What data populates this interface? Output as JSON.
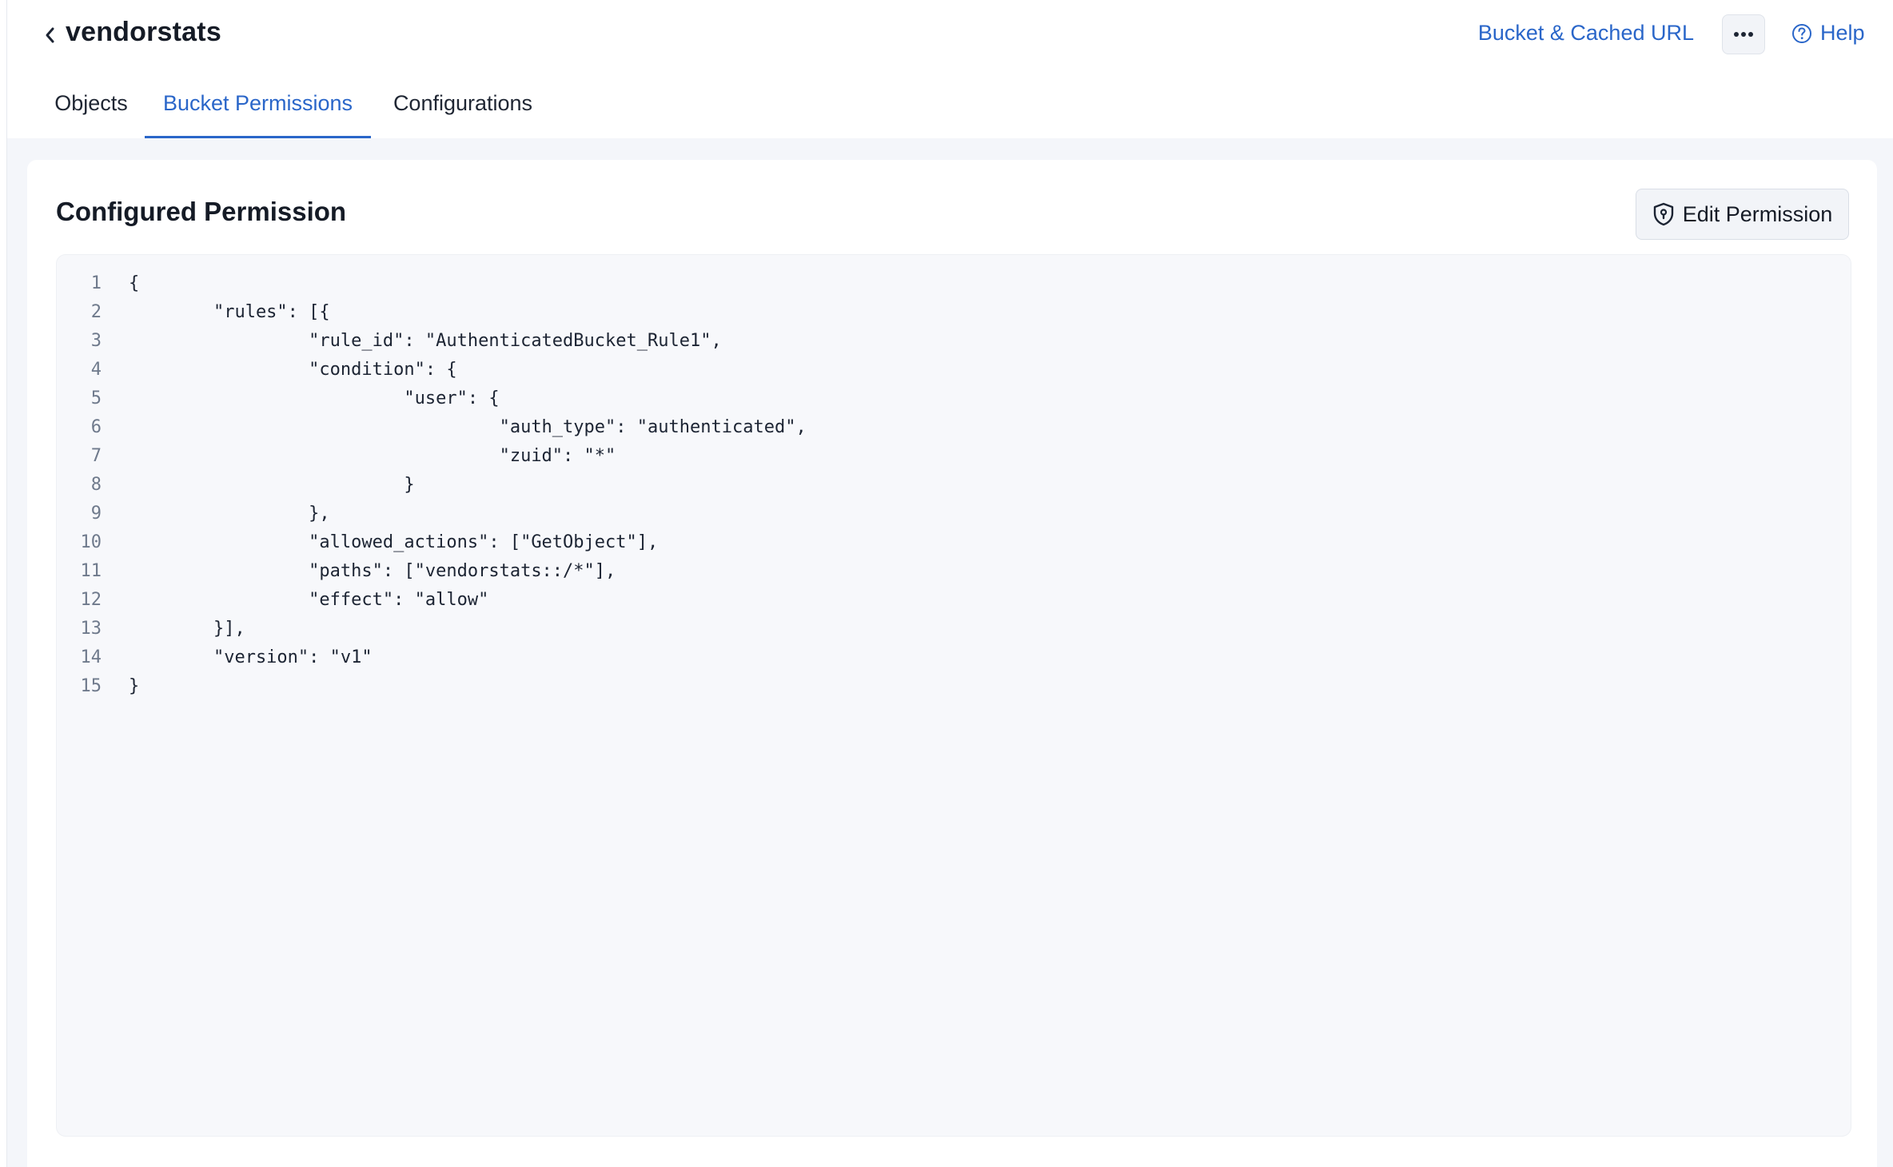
{
  "header": {
    "title": "vendorstats",
    "bucket_link": "Bucket & Cached URL",
    "help_label": "Help"
  },
  "tabs": [
    {
      "label": "Objects",
      "active": false
    },
    {
      "label": "Bucket Permissions",
      "active": true
    },
    {
      "label": "Configurations",
      "active": false
    }
  ],
  "permission": {
    "title": "Configured Permission",
    "edit_label": "Edit Permission",
    "code_lines": [
      {
        "num": "1",
        "text": "{"
      },
      {
        "num": "2",
        "text": "        \"rules\": [{"
      },
      {
        "num": "3",
        "text": "                 \"rule_id\": \"AuthenticatedBucket_Rule1\","
      },
      {
        "num": "4",
        "text": "                 \"condition\": {"
      },
      {
        "num": "5",
        "text": "                          \"user\": {"
      },
      {
        "num": "6",
        "text": "                                   \"auth_type\": \"authenticated\","
      },
      {
        "num": "7",
        "text": "                                   \"zuid\": \"*\""
      },
      {
        "num": "8",
        "text": "                          }"
      },
      {
        "num": "9",
        "text": "                 },"
      },
      {
        "num": "10",
        "text": "                 \"allowed_actions\": [\"GetObject\"],"
      },
      {
        "num": "11",
        "text": "                 \"paths\": [\"vendorstats::/*\"],"
      },
      {
        "num": "12",
        "text": "                 \"effect\": \"allow\""
      },
      {
        "num": "13",
        "text": "        }],"
      },
      {
        "num": "14",
        "text": "        \"version\": \"v1\""
      },
      {
        "num": "15",
        "text": "}"
      }
    ]
  },
  "colors": {
    "accent": "#2a66c9",
    "page_bg": "#f4f6fa"
  }
}
